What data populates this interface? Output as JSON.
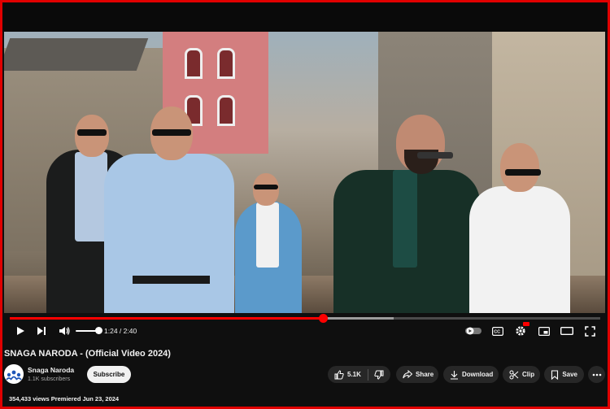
{
  "video": {
    "progress_fraction": 0.53,
    "loaded_fraction": 0.65,
    "volume_fraction": 1.0
  },
  "player": {
    "time_current": "1:24",
    "time_total": "2:40",
    "time_display": "1:24 / 2:40"
  },
  "info": {
    "title": "SNAGA NARODA - (Official Video 2024)",
    "channel_name": "Snaga Naroda",
    "subscribers": "1.1K subscribers",
    "subscribe_label": "Subscribe",
    "like_count": "5.1K",
    "share_label": "Share",
    "download_label": "Download",
    "clip_label": "Clip",
    "save_label": "Save",
    "stats": "354,433 views  Premiered Jun 23, 2024"
  },
  "colors": {
    "accent": "#ff0000",
    "border": "#e00000",
    "background": "#0f0f0f"
  }
}
